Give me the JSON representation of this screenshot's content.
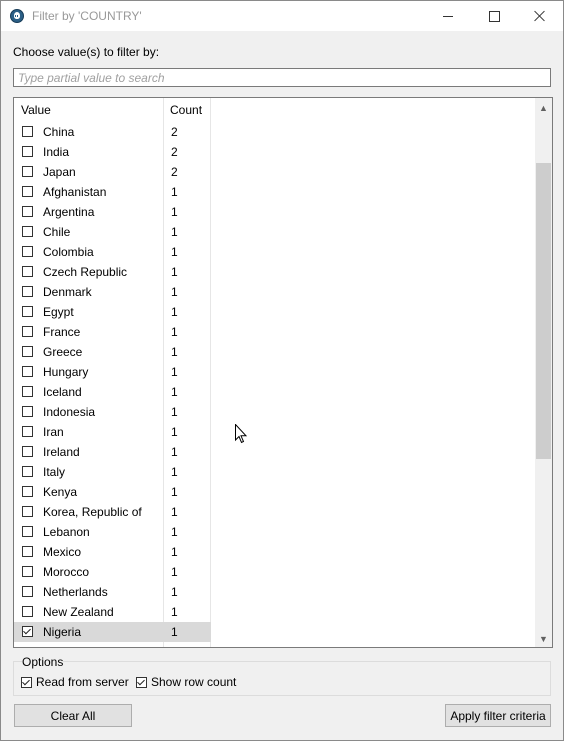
{
  "window": {
    "title": "Filter by 'COUNTRY'"
  },
  "prompt": "Choose value(s) to filter by:",
  "search": {
    "placeholder": "Type partial value to search",
    "value": ""
  },
  "columns": {
    "value": "Value",
    "count": "Count"
  },
  "rows": [
    {
      "label": "China",
      "count": "2",
      "checked": false
    },
    {
      "label": "India",
      "count": "2",
      "checked": false
    },
    {
      "label": "Japan",
      "count": "2",
      "checked": false
    },
    {
      "label": "Afghanistan",
      "count": "1",
      "checked": false
    },
    {
      "label": "Argentina",
      "count": "1",
      "checked": false
    },
    {
      "label": "Chile",
      "count": "1",
      "checked": false
    },
    {
      "label": "Colombia",
      "count": "1",
      "checked": false
    },
    {
      "label": "Czech Republic",
      "count": "1",
      "checked": false
    },
    {
      "label": "Denmark",
      "count": "1",
      "checked": false
    },
    {
      "label": "Egypt",
      "count": "1",
      "checked": false
    },
    {
      "label": "France",
      "count": "1",
      "checked": false
    },
    {
      "label": "Greece",
      "count": "1",
      "checked": false
    },
    {
      "label": "Hungary",
      "count": "1",
      "checked": false
    },
    {
      "label": "Iceland",
      "count": "1",
      "checked": false
    },
    {
      "label": "Indonesia",
      "count": "1",
      "checked": false
    },
    {
      "label": "Iran",
      "count": "1",
      "checked": false
    },
    {
      "label": "Ireland",
      "count": "1",
      "checked": false
    },
    {
      "label": "Italy",
      "count": "1",
      "checked": false
    },
    {
      "label": "Kenya",
      "count": "1",
      "checked": false
    },
    {
      "label": "Korea, Republic of",
      "count": "1",
      "checked": false
    },
    {
      "label": "Lebanon",
      "count": "1",
      "checked": false
    },
    {
      "label": "Mexico",
      "count": "1",
      "checked": false
    },
    {
      "label": "Morocco",
      "count": "1",
      "checked": false
    },
    {
      "label": "Netherlands",
      "count": "1",
      "checked": false
    },
    {
      "label": "New Zealand",
      "count": "1",
      "checked": false
    },
    {
      "label": "Nigeria",
      "count": "1",
      "checked": true,
      "selected": true
    }
  ],
  "options": {
    "title": "Options",
    "read_from_server": {
      "label": "Read from server",
      "checked": true
    },
    "show_row_count": {
      "label": "Show row count",
      "checked": true
    }
  },
  "buttons": {
    "clear_all": "Clear All",
    "apply": "Apply filter criteria"
  },
  "colors": {
    "selection": "#d9d9d9",
    "scroll_thumb": "#cdcdcd",
    "dialog_bg": "#f0f0f0"
  }
}
